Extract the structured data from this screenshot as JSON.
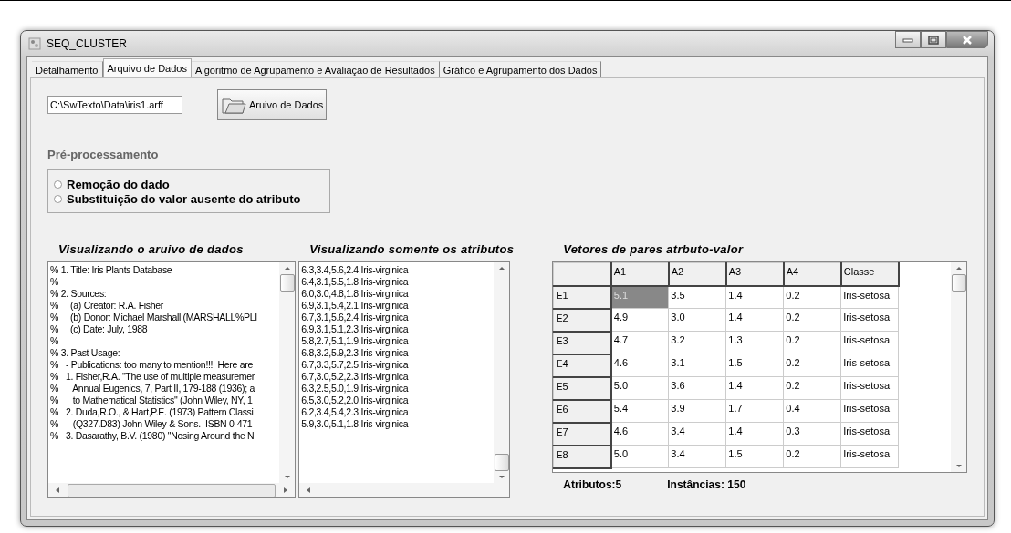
{
  "window": {
    "title": "SEQ_CLUSTER"
  },
  "tabs": [
    {
      "label": "Detalhamento",
      "selected": false
    },
    {
      "label": "Arquivo de Dados",
      "selected": true
    },
    {
      "label": "Algoritmo de Agrupamento e Avaliação de Resultados",
      "selected": false
    },
    {
      "label": "Gráfico e Agrupamento dos Dados",
      "selected": false
    }
  ],
  "file_field": {
    "value": "C:\\SwTexto\\Data\\iris1.arff"
  },
  "file_button": {
    "label": "Aruivo de Dados"
  },
  "preprocessing": {
    "title": "Pré-processamento",
    "options": [
      {
        "label": "Remoção do dado",
        "checked": false
      },
      {
        "label": "Substituição do valor ausente do atributo",
        "checked": false
      }
    ]
  },
  "file_view": {
    "title": "Visualizando o aruivo de dados",
    "lines": [
      "% 1. Title: Iris Plants Database",
      "%",
      "% 2. Sources:",
      "%     (a) Creator: R.A. Fisher",
      "%     (b) Donor: Michael Marshall (MARSHALL%PLI",
      "%     (c) Date: July, 1988",
      "%",
      "% 3. Past Usage:",
      "%   - Publications: too many to mention!!!  Here are",
      "%   1. Fisher,R.A. \"The use of multiple measuremer",
      "%      Annual Eugenics, 7, Part II, 179-188 (1936); a",
      "%      to Mathematical Statistics\" (John Wiley, NY, 1",
      "%   2. Duda,R.O., & Hart,P.E. (1973) Pattern Classi",
      "%      (Q327.D83) John Wiley & Sons.  ISBN 0-471-",
      "%   3. Dasarathy, B.V. (1980) \"Nosing Around the N"
    ]
  },
  "attributes_view": {
    "title": "Visualizando somente os atributos",
    "lines": [
      "6.3,3.4,5.6,2.4,Iris-virginica",
      "6.4,3.1,5.5,1.8,Iris-virginica",
      "6.0,3.0,4.8,1.8,Iris-virginica",
      "6.9,3.1,5.4,2.1,Iris-virginica",
      "6.7,3.1,5.6,2.4,Iris-virginica",
      "6.9,3.1,5.1,2.3,Iris-virginica",
      "5.8,2.7,5.1,1.9,Iris-virginica",
      "6.8,3.2,5.9,2.3,Iris-virginica",
      "6.7,3.3,5.7,2.5,Iris-virginica",
      "6.7,3.0,5.2,2.3,Iris-virginica",
      "6.3,2.5,5.0,1.9,Iris-virginica",
      "6.5,3.0,5.2,2.0,Iris-virginica",
      "6.2,3.4,5.4,2.3,Iris-virginica",
      "5.9,3.0,5.1,1.8,Iris-virginica"
    ]
  },
  "table": {
    "title": "Vetores de pares atrbuto-valor",
    "columns": [
      "A1",
      "A2",
      "A3",
      "A4",
      "Classe"
    ],
    "rows": [
      {
        "header": "E1",
        "cells": [
          {
            "text": "5.1",
            "selected": true
          },
          {
            "text": "3.5",
            "selected": false
          },
          {
            "text": "1.4",
            "selected": false
          },
          {
            "text": "0.2",
            "selected": false
          },
          {
            "text": "Iris-setosa",
            "selected": false
          }
        ]
      },
      {
        "header": "E2",
        "cells": [
          {
            "text": "4.9",
            "selected": false
          },
          {
            "text": "3.0",
            "selected": false
          },
          {
            "text": "1.4",
            "selected": false
          },
          {
            "text": "0.2",
            "selected": false
          },
          {
            "text": "Iris-setosa",
            "selected": false
          }
        ]
      },
      {
        "header": "E3",
        "cells": [
          {
            "text": "4.7",
            "selected": false
          },
          {
            "text": "3.2",
            "selected": false
          },
          {
            "text": "1.3",
            "selected": false
          },
          {
            "text": "0.2",
            "selected": false
          },
          {
            "text": "Iris-setosa",
            "selected": false
          }
        ]
      },
      {
        "header": "E4",
        "cells": [
          {
            "text": "4.6",
            "selected": false
          },
          {
            "text": "3.1",
            "selected": false
          },
          {
            "text": "1.5",
            "selected": false
          },
          {
            "text": "0.2",
            "selected": false
          },
          {
            "text": "Iris-setosa",
            "selected": false
          }
        ]
      },
      {
        "header": "E5",
        "cells": [
          {
            "text": "5.0",
            "selected": false
          },
          {
            "text": "3.6",
            "selected": false
          },
          {
            "text": "1.4",
            "selected": false
          },
          {
            "text": "0.2",
            "selected": false
          },
          {
            "text": "Iris-setosa",
            "selected": false
          }
        ]
      },
      {
        "header": "E6",
        "cells": [
          {
            "text": "5.4",
            "selected": false
          },
          {
            "text": "3.9",
            "selected": false
          },
          {
            "text": "1.7",
            "selected": false
          },
          {
            "text": "0.4",
            "selected": false
          },
          {
            "text": "Iris-setosa",
            "selected": false
          }
        ]
      },
      {
        "header": "E7",
        "cells": [
          {
            "text": "4.6",
            "selected": false
          },
          {
            "text": "3.4",
            "selected": false
          },
          {
            "text": "1.4",
            "selected": false
          },
          {
            "text": "0.3",
            "selected": false
          },
          {
            "text": "Iris-setosa",
            "selected": false
          }
        ]
      },
      {
        "header": "E8",
        "cells": [
          {
            "text": "5.0",
            "selected": false
          },
          {
            "text": "3.4",
            "selected": false
          },
          {
            "text": "1.5",
            "selected": false
          },
          {
            "text": "0.2",
            "selected": false
          },
          {
            "text": "Iris-setosa",
            "selected": false
          }
        ]
      }
    ]
  },
  "status": {
    "attributes": "Atributos:5",
    "instances": "Instâncias: 150"
  }
}
